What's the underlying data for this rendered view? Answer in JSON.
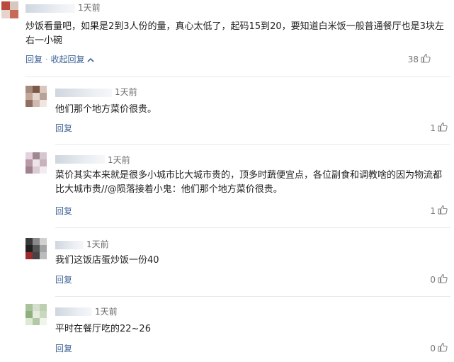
{
  "comments": [
    {
      "time": "1天前",
      "text": "炒饭看量吧，如果是2到3人份的量，真心太低了，起码15到20，要知道白米饭一般普通餐厅也是3块左右一小碗",
      "reply": "回复",
      "collapse": "收起回复",
      "likes": "38"
    },
    {
      "time": "1天前",
      "text": "他们那个地方菜价很贵。",
      "reply": "回复",
      "likes": "1"
    },
    {
      "time": "1天前",
      "text": "菜价其实本来就是很多小城市比大城市贵的，顶多时蔬便宜点，各位副食和调教啥的因为物流都比大城市贵//@陨落接着小鬼：他们那个地方菜价很贵。",
      "reply": "回复",
      "likes": "1"
    },
    {
      "time": "1天前",
      "text": "我们这饭店蛋炒饭一份40",
      "reply": "回复",
      "likes": "0"
    },
    {
      "time": "1天前",
      "text": "平时在餐厅吃的22~26",
      "reply": "回复",
      "likes": "0"
    }
  ],
  "icons": {
    "like": "thumbs-up-icon",
    "collapse": "chevron-up-icon"
  },
  "colors": {
    "link": "#406599",
    "text": "#222222",
    "meta": "#6b6b6b"
  }
}
